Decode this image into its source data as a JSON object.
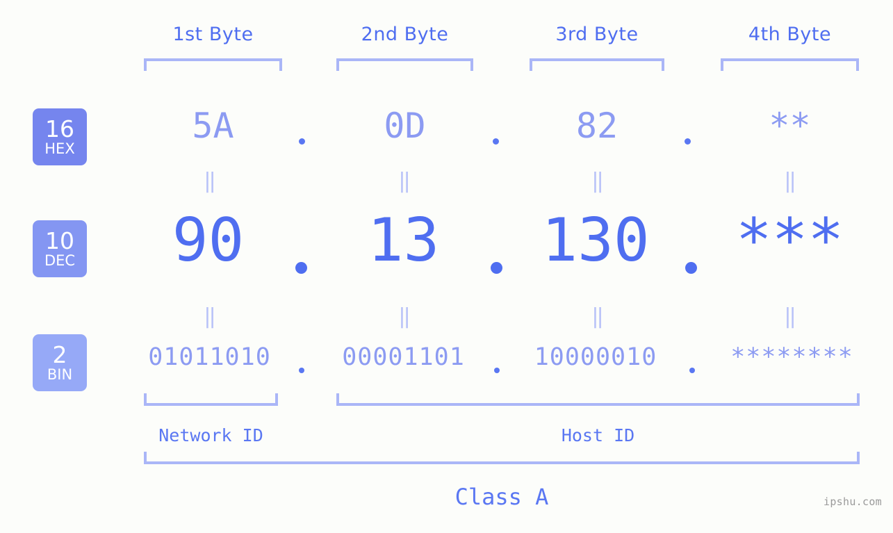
{
  "background_color": "#fcfdfa",
  "accent_color": "#4f6ef0",
  "accent_light_color": "#8c9bf2",
  "bracket_color": "#aab6f7",
  "byte_headers": [
    {
      "label": "1st Byte"
    },
    {
      "label": "2nd Byte"
    },
    {
      "label": "3rd Byte"
    },
    {
      "label": "4th Byte"
    }
  ],
  "rows": [
    {
      "badge_number": "16",
      "badge_label": "HEX",
      "badge_color": "#7585ee",
      "values": [
        "5A",
        "0D",
        "82",
        "**"
      ]
    },
    {
      "badge_number": "10",
      "badge_label": "DEC",
      "badge_color": "#8496f2",
      "values": [
        "90",
        "13",
        "130",
        "***"
      ]
    },
    {
      "badge_number": "2",
      "badge_label": "BIN",
      "badge_color": "#96a9f7",
      "values": [
        "01011010",
        "00001101",
        "10000010",
        "********"
      ]
    }
  ],
  "separators": {
    "dot": ".",
    "equals_mark": "‖"
  },
  "segments": {
    "network_id": "Network ID",
    "host_id": "Host ID"
  },
  "class_label": "Class A",
  "watermark": "ipshu.com"
}
